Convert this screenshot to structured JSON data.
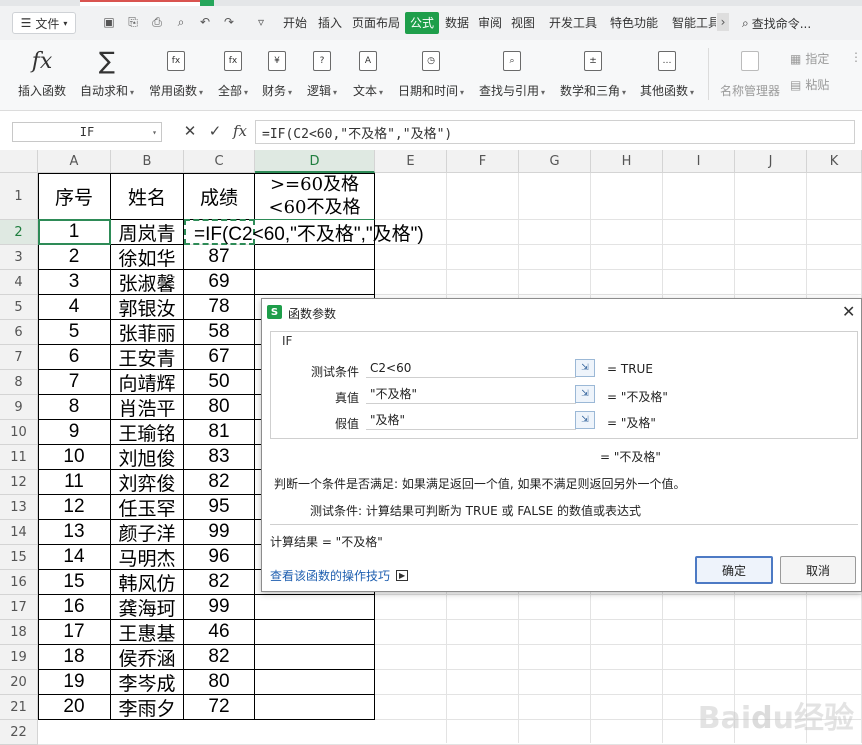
{
  "toolbar": {
    "menu_label": "文件",
    "tabs": [
      "开始",
      "插入",
      "页面布局",
      "公式",
      "数据",
      "审阅",
      "视图",
      "开发工具",
      "特色功能",
      "智能工具"
    ],
    "active_tab": "公式",
    "search_placeholder": "查找命令..."
  },
  "ribbon": {
    "buttons": [
      {
        "label": "插入函数",
        "icon": "fx-icon",
        "glyph": "fx"
      },
      {
        "label": "自动求和",
        "icon": "sigma-icon",
        "glyph": "∑"
      },
      {
        "label": "常用函数",
        "icon": "common-function-icon",
        "glyph": "fx"
      },
      {
        "label": "全部",
        "icon": "all-functions-icon",
        "glyph": "fx"
      },
      {
        "label": "财务",
        "icon": "finance-icon",
        "glyph": "¥"
      },
      {
        "label": "逻辑",
        "icon": "logic-icon",
        "glyph": "?"
      },
      {
        "label": "文本",
        "icon": "text-icon",
        "glyph": "A"
      },
      {
        "label": "日期和时间",
        "icon": "datetime-icon",
        "glyph": "◷"
      },
      {
        "label": "查找与引用",
        "icon": "lookup-icon",
        "glyph": "⌕"
      },
      {
        "label": "数学和三角",
        "icon": "math-icon",
        "glyph": "±"
      },
      {
        "label": "其他函数",
        "icon": "other-functions-icon",
        "glyph": "…"
      },
      {
        "label": "名称管理器",
        "icon": "name-manager-icon",
        "glyph": ""
      }
    ],
    "side": {
      "specify": "指定",
      "paste": "粘贴"
    }
  },
  "formula_bar": {
    "name_box": "IF",
    "formula": "=IF(C2<60,\"不及格\",\"及格\")"
  },
  "sheet": {
    "columns": [
      "A",
      "B",
      "C",
      "D",
      "E",
      "F",
      "G",
      "H",
      "I",
      "J",
      "K"
    ],
    "rows": [
      "1",
      "2",
      "3",
      "4",
      "5",
      "6",
      "7",
      "8",
      "9",
      "10",
      "11",
      "12",
      "13",
      "14",
      "15",
      "16",
      "17",
      "18",
      "19",
      "20",
      "21",
      "22"
    ],
    "header": {
      "a": "序号",
      "b": "姓名",
      "c": "成绩",
      "d_line1": ">=60及格",
      "d_line2": "<60不及格"
    },
    "editing_formula": "=IF(C2<60,\"不及格\",\"及格\")",
    "data": [
      {
        "no": "1",
        "name": "周岚青",
        "score": ""
      },
      {
        "no": "2",
        "name": "徐如华",
        "score": "87"
      },
      {
        "no": "3",
        "name": "张淑馨",
        "score": "69"
      },
      {
        "no": "4",
        "name": "郭银汝",
        "score": "78"
      },
      {
        "no": "5",
        "name": "张菲丽",
        "score": "58"
      },
      {
        "no": "6",
        "name": "王安青",
        "score": "67"
      },
      {
        "no": "7",
        "name": "向靖辉",
        "score": "50"
      },
      {
        "no": "8",
        "name": "肖浩平",
        "score": "80"
      },
      {
        "no": "9",
        "name": "王瑜铭",
        "score": "81"
      },
      {
        "no": "10",
        "name": "刘旭俊",
        "score": "83"
      },
      {
        "no": "11",
        "name": "刘弈俊",
        "score": "82"
      },
      {
        "no": "12",
        "name": "任玉罕",
        "score": "95"
      },
      {
        "no": "13",
        "name": "颜子洋",
        "score": "99"
      },
      {
        "no": "14",
        "name": "马明杰",
        "score": "96"
      },
      {
        "no": "15",
        "name": "韩风仿",
        "score": "82"
      },
      {
        "no": "16",
        "name": "龚海珂",
        "score": "99"
      },
      {
        "no": "17",
        "name": "王惠基",
        "score": "46"
      },
      {
        "no": "18",
        "name": "侯乔涵",
        "score": "82"
      },
      {
        "no": "19",
        "name": "李岑成",
        "score": "80"
      },
      {
        "no": "20",
        "name": "李雨夕",
        "score": "72"
      }
    ]
  },
  "dialog": {
    "title": "函数参数",
    "function_name": "IF",
    "params": [
      {
        "label": "测试条件",
        "value": "C2<60",
        "result": "= TRUE"
      },
      {
        "label": "真值",
        "value": "\"不及格\"",
        "result": "= \"不及格\""
      },
      {
        "label": "假值",
        "value": "\"及格\"",
        "result": "= \"及格\""
      }
    ],
    "overall_result": "= \"不及格\"",
    "description": "判断一个条件是否满足: 如果满足返回一个值, 如果不满足则返回另外一个值。",
    "param_help": "测试条件:  计算结果可判断为 TRUE 或 FALSE 的数值或表达式",
    "calc_result": "计算结果 = \"不及格\"",
    "help_link": "查看该函数的操作技巧",
    "ok": "确定",
    "cancel": "取消"
  },
  "watermark": "Baidu经验"
}
